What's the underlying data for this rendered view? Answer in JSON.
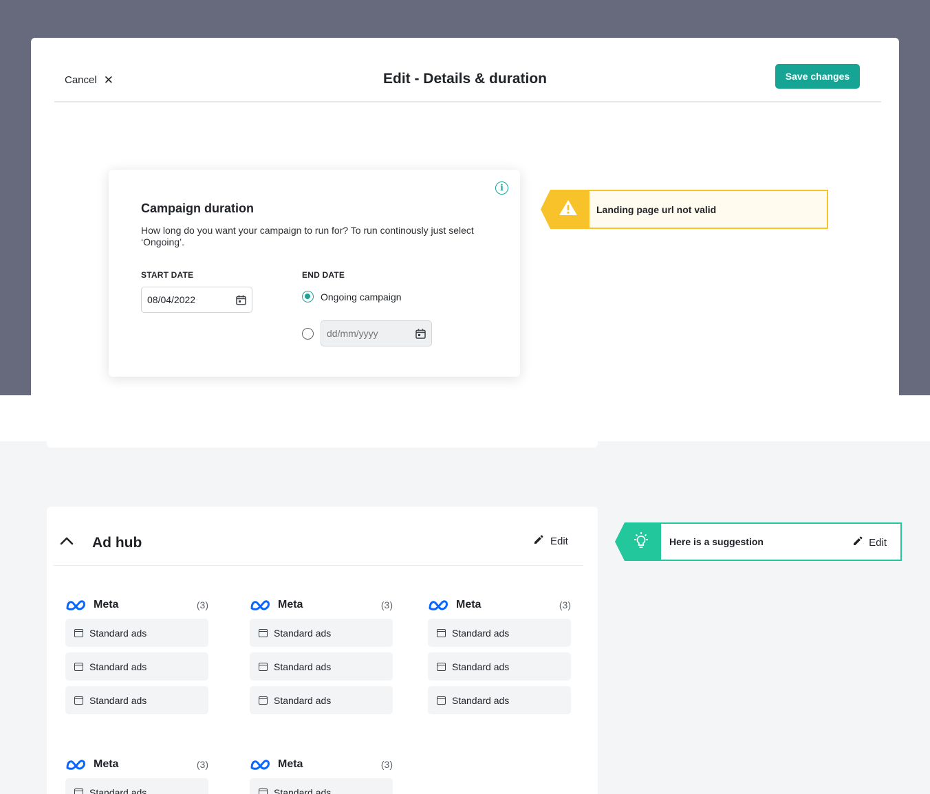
{
  "modal": {
    "cancel_label": "Cancel",
    "cancel_icon": "close-icon",
    "title": "Edit - Details & duration",
    "save_label": "Save changes"
  },
  "campaign_duration": {
    "title": "Campaign duration",
    "description": "How long do you want your campaign to run for? To run continously just select ‘Ongoing’.",
    "start_date_label": "START DATE",
    "start_date_value": "08/04/2022",
    "end_date_label": "END DATE",
    "ongoing_label": "Ongoing campaign",
    "ongoing_selected": true,
    "end_date_placeholder": "dd/mm/yyyy"
  },
  "warning": {
    "message": "Landing page url not valid",
    "icon": "warning-icon",
    "color": "#f8c22a"
  },
  "ad_hub": {
    "title": "Ad hub",
    "edit_label": "Edit",
    "groups": [
      {
        "name": "Meta",
        "count": "(3)",
        "items": [
          "Standard ads",
          "Standard ads",
          "Standard ads"
        ]
      },
      {
        "name": "Meta",
        "count": "(3)",
        "items": [
          "Standard ads",
          "Standard ads",
          "Standard ads"
        ]
      },
      {
        "name": "Meta",
        "count": "(3)",
        "items": [
          "Standard ads",
          "Standard ads",
          "Standard ads"
        ]
      },
      {
        "name": "Meta",
        "count": "(3)",
        "items": [
          "Standard ads"
        ]
      },
      {
        "name": "Meta",
        "count": "(3)",
        "items": [
          "Standard ads"
        ]
      }
    ]
  },
  "suggestion": {
    "message": "Here is a suggestion",
    "edit_label": "Edit",
    "icon": "lightbulb-icon",
    "color": "#22c79c"
  },
  "colors": {
    "accent": "#16a595",
    "overlay": "#676a7d",
    "warning": "#f8c22a",
    "suggestion": "#22c79c",
    "meta_blue": "#0866ff"
  }
}
